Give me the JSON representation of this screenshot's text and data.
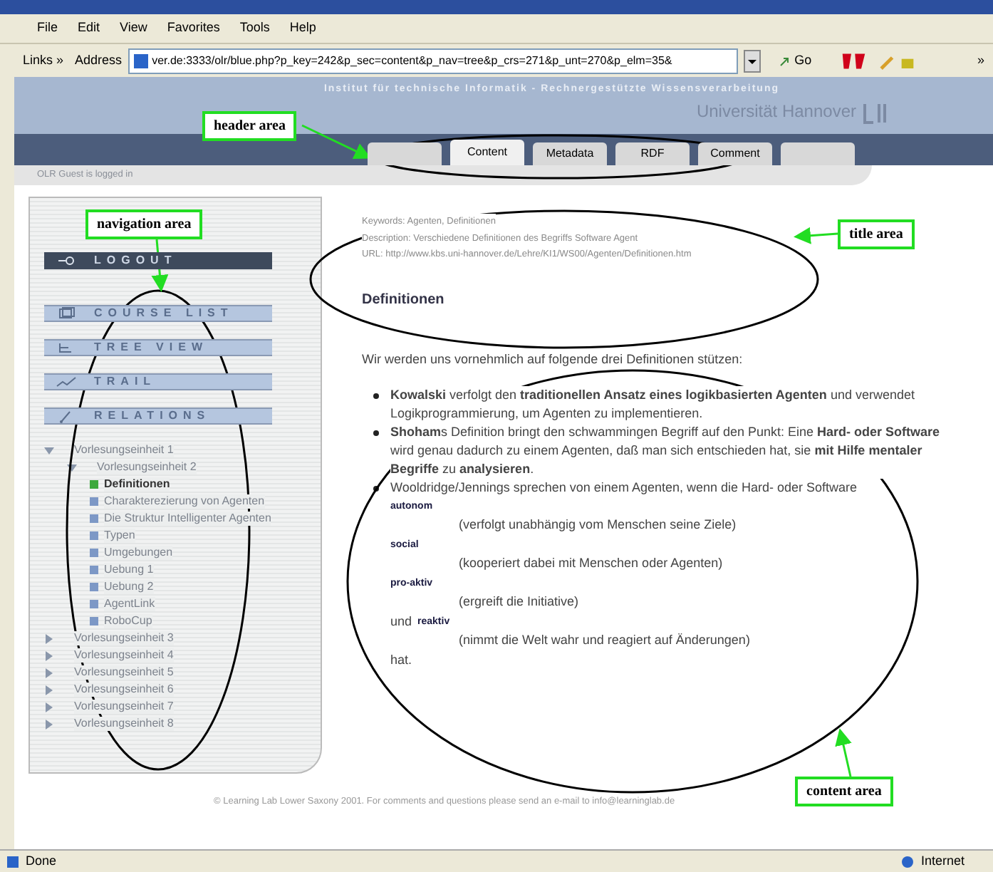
{
  "menu": [
    "File",
    "Edit",
    "View",
    "Favorites",
    "Tools",
    "Help"
  ],
  "address_bar": {
    "links": "Links »",
    "label": "Address",
    "url": "ver.de:3333/olr/blue.php?p_key=242&p_sec=content&p_nav=tree&p_crs=271&p_unt=270&p_elm=35&",
    "go": "Go",
    "more": "»"
  },
  "header": {
    "institute": "Institut für technische Informatik - Rechnergestützte Wissensverarbeitung",
    "university": "Universität Hannover"
  },
  "tabs": [
    {
      "kind": "empty",
      "selected": false
    },
    {
      "kind": "text",
      "label": "Content",
      "selected": true
    },
    {
      "kind": "text",
      "label": "Metadata",
      "selected": false
    },
    {
      "kind": "text",
      "label": "RDF",
      "selected": false
    },
    {
      "kind": "text",
      "label": "Comment",
      "selected": false
    },
    {
      "kind": "empty",
      "selected": false
    }
  ],
  "login_status": "OLR Guest is logged in",
  "nav_buttons": [
    {
      "kind": "logout",
      "label": "LOGOUT"
    },
    {
      "kind": "courses",
      "label": "COURSE LIST"
    },
    {
      "kind": "tree",
      "label": "TREE VIEW"
    },
    {
      "kind": "trail",
      "label": "TRAIL"
    },
    {
      "kind": "relations",
      "label": "RELATIONS"
    }
  ],
  "tree": [
    {
      "label": "Vorlesungseinheit 1",
      "expanded": true,
      "children": [
        {
          "label": "Vorlesungseinheit 2",
          "expanded": true,
          "children": [
            {
              "label": "Definitionen",
              "selected": true
            },
            {
              "label": "Charakterezierung von Agenten",
              "selected": false
            },
            {
              "label": "Die Struktur Intelligenter Agenten",
              "selected": false
            },
            {
              "label": "Typen",
              "selected": false
            },
            {
              "label": "Umgebungen",
              "selected": false
            },
            {
              "label": "Uebung 1",
              "selected": false
            },
            {
              "label": "Uebung 2",
              "selected": false
            },
            {
              "label": "AgentLink",
              "selected": false
            },
            {
              "label": "RoboCup",
              "selected": false
            }
          ]
        }
      ]
    },
    {
      "label": "Vorlesungseinheit 3",
      "expanded": false
    },
    {
      "label": "Vorlesungseinheit 4",
      "expanded": false
    },
    {
      "label": "Vorlesungseinheit 5",
      "expanded": false
    },
    {
      "label": "Vorlesungseinheit 6",
      "expanded": false
    },
    {
      "label": "Vorlesungseinheit 7",
      "expanded": false
    },
    {
      "label": "Vorlesungseinheit 8",
      "expanded": false
    }
  ],
  "metadata": [
    "Keywords: Agenten, Definitionen",
    "Description: Verschiedene Definitionen des Begriffs Software Agent",
    "URL: http://www.kbs.uni-hannover.de/Lehre/KI1/WS00/Agenten/Definitionen.htm"
  ],
  "heading": "Definitionen",
  "intro": "Wir werden uns vornehmlich auf folgende drei Definitionen stützen:",
  "bullets": [
    "**Kowalski** verfolgt den **traditionellen Ansatz eines logikbasierten Agenten** und verwendet Logikprogrammierung, um Agenten zu implementieren.",
    "**Shoham**s Definition bringt den schwammingen Begriff auf den Punkt: Eine **Hard- oder Software** wird genau dadurch zu einem Agenten, daß man sich entschieden hat, sie **mit Hilfe mentaler Begriffe** zu **analysieren**.",
    "Wooldridge/Jennings sprechen von einem Agenten, wenn die Hard- oder Software"
  ],
  "definitions": [
    {
      "term": "autonom",
      "description": "(verfolgt unabhängig vom Menschen seine Ziele)"
    },
    {
      "term": "social",
      "description": "(kooperiert dabei mit Menschen oder Agenten)"
    },
    {
      "term": "pro-aktiv",
      "description": "(ergreift die Initiative)"
    },
    {
      "lead": "und",
      "term": "reaktiv",
      "description": "(nimmt die Welt wahr und reagiert auf Änderungen)"
    }
  ],
  "closing": "hat.",
  "footer": "© Learning Lab Lower Saxony 2001. For comments and questions please send an e-mail to info@learninglab.de",
  "status_bar": {
    "text": "Done",
    "zone": "Internet"
  },
  "annotations": {
    "header": "header area",
    "navigation": "navigation area",
    "title": "title area",
    "content": "content area"
  }
}
